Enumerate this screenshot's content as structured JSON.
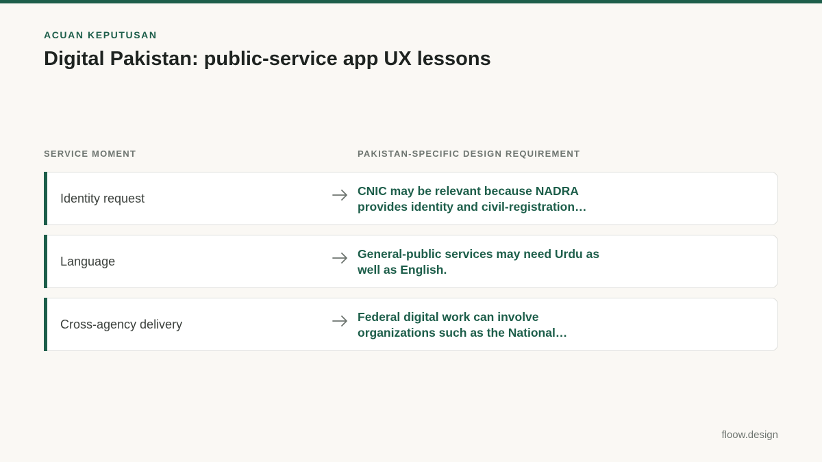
{
  "header": {
    "eyebrow": "ACUAN KEPUTUSAN",
    "title": "Digital Pakistan: public-service app UX lessons"
  },
  "columns": {
    "left": "SERVICE MOMENT",
    "right": "PAKISTAN-SPECIFIC DESIGN REQUIREMENT"
  },
  "rows": [
    {
      "moment": "Identity request",
      "requirement_line1": "CNIC may be relevant because NADRA",
      "requirement_line2": "provides identity and civil-registration…"
    },
    {
      "moment": "Language",
      "requirement_line1": "General-public services may need Urdu as",
      "requirement_line2": "well as English."
    },
    {
      "moment": "Cross-agency delivery",
      "requirement_line1": "Federal digital work can involve",
      "requirement_line2": "organizations such as the National…"
    }
  ],
  "footer": {
    "brand": "floow.design"
  },
  "colors": {
    "accent": "#1d5e4a",
    "background": "#faf8f4",
    "title": "#1e2320",
    "muted": "#6e7570"
  },
  "icons": {
    "row_connector": "arrow-right-icon"
  }
}
